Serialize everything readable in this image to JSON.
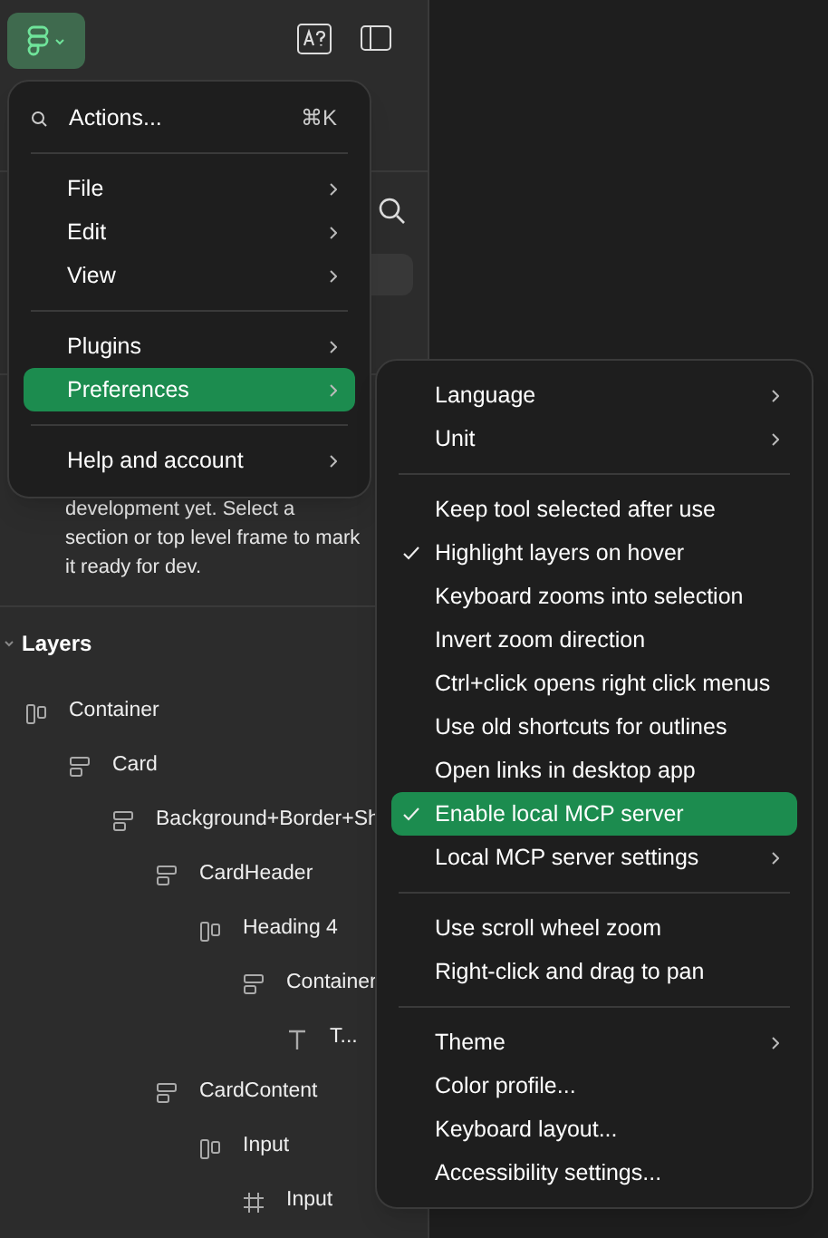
{
  "toolbar": {
    "logo_button": {
      "expanded": true
    }
  },
  "sidebar": {
    "notice_lines": [
      "development yet. Select a",
      "section or top level frame to mark",
      "it ready for dev."
    ],
    "layers": {
      "title": "Layers",
      "expanded": true,
      "items": [
        {
          "label": "Container",
          "kind": "autolayout-h",
          "children": [
            {
              "label": "Card",
              "kind": "autolayout-v",
              "children": [
                {
                  "label": "Background+Border+Sh",
                  "kind": "autolayout-v",
                  "children": [
                    {
                      "label": "CardHeader",
                      "kind": "autolayout-v",
                      "children": [
                        {
                          "label": "Heading 4",
                          "kind": "autolayout-h",
                          "children": [
                            {
                              "label": "Container",
                              "kind": "autolayout-v",
                              "children": [
                                {
                                  "label": "T...",
                                  "kind": "text"
                                }
                              ]
                            }
                          ]
                        }
                      ]
                    },
                    {
                      "label": "CardContent",
                      "kind": "autolayout-v",
                      "children": [
                        {
                          "label": "Input",
                          "kind": "autolayout-h",
                          "children": [
                            {
                              "label": "Input",
                              "kind": "frame"
                            }
                          ]
                        }
                      ]
                    }
                  ]
                }
              ]
            }
          ]
        }
      ]
    }
  },
  "main_menu": {
    "items": [
      {
        "kind": "search",
        "label": "Actions...",
        "shortcut": "⌘K"
      },
      {
        "kind": "separator"
      },
      {
        "kind": "item",
        "label": "File",
        "submenu": true,
        "selected": false
      },
      {
        "kind": "item",
        "label": "Edit",
        "submenu": true,
        "selected": false
      },
      {
        "kind": "item",
        "label": "View",
        "submenu": true,
        "selected": false
      },
      {
        "kind": "separator"
      },
      {
        "kind": "item",
        "label": "Plugins",
        "submenu": true,
        "selected": false
      },
      {
        "kind": "item",
        "label": "Preferences",
        "submenu": true,
        "selected": true
      },
      {
        "kind": "separator"
      },
      {
        "kind": "item",
        "label": "Help and account",
        "submenu": true,
        "selected": false
      }
    ]
  },
  "preferences_menu": {
    "items": [
      {
        "kind": "item",
        "label": "Language",
        "submenu": true,
        "checked": false,
        "selected": false
      },
      {
        "kind": "item",
        "label": "Unit",
        "submenu": true,
        "checked": false,
        "selected": false
      },
      {
        "kind": "separator"
      },
      {
        "kind": "item",
        "label": "Keep tool selected after use",
        "submenu": false,
        "checked": false,
        "selected": false
      },
      {
        "kind": "item",
        "label": "Highlight layers on hover",
        "submenu": false,
        "checked": true,
        "selected": false
      },
      {
        "kind": "item",
        "label": "Keyboard zooms into selection",
        "submenu": false,
        "checked": false,
        "selected": false
      },
      {
        "kind": "item",
        "label": "Invert zoom direction",
        "submenu": false,
        "checked": false,
        "selected": false
      },
      {
        "kind": "item",
        "label": "Ctrl+click opens right click menus",
        "submenu": false,
        "checked": false,
        "selected": false
      },
      {
        "kind": "item",
        "label": "Use old shortcuts for outlines",
        "submenu": false,
        "checked": false,
        "selected": false
      },
      {
        "kind": "item",
        "label": "Open links in desktop app",
        "submenu": false,
        "checked": false,
        "selected": false
      },
      {
        "kind": "item",
        "label": "Enable local MCP server",
        "submenu": false,
        "checked": true,
        "selected": true
      },
      {
        "kind": "item",
        "label": "Local MCP server settings",
        "submenu": true,
        "checked": false,
        "selected": false
      },
      {
        "kind": "separator"
      },
      {
        "kind": "item",
        "label": "Use scroll wheel zoom",
        "submenu": false,
        "checked": false,
        "selected": false
      },
      {
        "kind": "item",
        "label": "Right-click and drag to pan",
        "submenu": false,
        "checked": false,
        "selected": false
      },
      {
        "kind": "separator"
      },
      {
        "kind": "item",
        "label": "Theme",
        "submenu": true,
        "checked": false,
        "selected": false
      },
      {
        "kind": "item",
        "label": "Color profile...",
        "submenu": false,
        "checked": false,
        "selected": false
      },
      {
        "kind": "item",
        "label": "Keyboard layout...",
        "submenu": false,
        "checked": false,
        "selected": false
      },
      {
        "kind": "item",
        "label": "Accessibility settings...",
        "submenu": false,
        "checked": false,
        "selected": false
      }
    ]
  }
}
